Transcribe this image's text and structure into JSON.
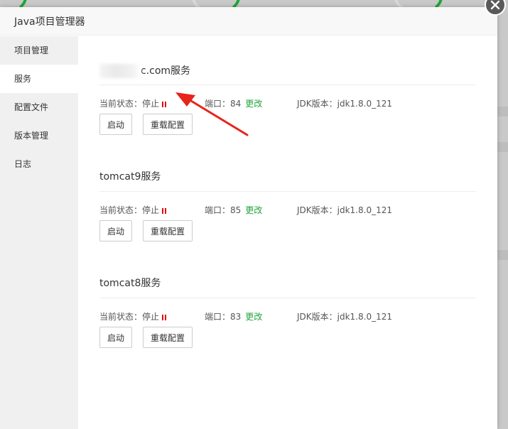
{
  "dialog": {
    "title": "Java项目管理器"
  },
  "sidebar": {
    "items": [
      {
        "label": "项目管理",
        "active": false
      },
      {
        "label": "服务",
        "active": true
      },
      {
        "label": "配置文件",
        "active": false
      },
      {
        "label": "版本管理",
        "active": false
      },
      {
        "label": "日志",
        "active": false
      }
    ]
  },
  "services": [
    {
      "title": "c.com服务",
      "status_label": "当前状态：停止",
      "port_label": "端口：84",
      "edit_label": "更改",
      "jdk_label": "JDK版本：jdk1.8.0_121",
      "start_label": "启动",
      "reload_label": "重载配置"
    },
    {
      "title": "tomcat9服务",
      "status_label": "当前状态：停止",
      "port_label": "端口：85",
      "edit_label": "更改",
      "jdk_label": "JDK版本：jdk1.8.0_121",
      "start_label": "启动",
      "reload_label": "重载配置"
    },
    {
      "title": "tomcat8服务",
      "status_label": "当前状态：停止",
      "port_label": "端口：83",
      "edit_label": "更改",
      "jdk_label": "JDK版本：jdk1.8.0_121",
      "start_label": "启动",
      "reload_label": "重载配置"
    }
  ],
  "icons": {
    "close": "close-icon",
    "status": "pause-icon",
    "annotation": "red-arrow"
  },
  "colors": {
    "accent_green": "#20a53a",
    "status_red": "#e60012",
    "arrow_red": "#e8231b",
    "close_bg": "#595959"
  }
}
